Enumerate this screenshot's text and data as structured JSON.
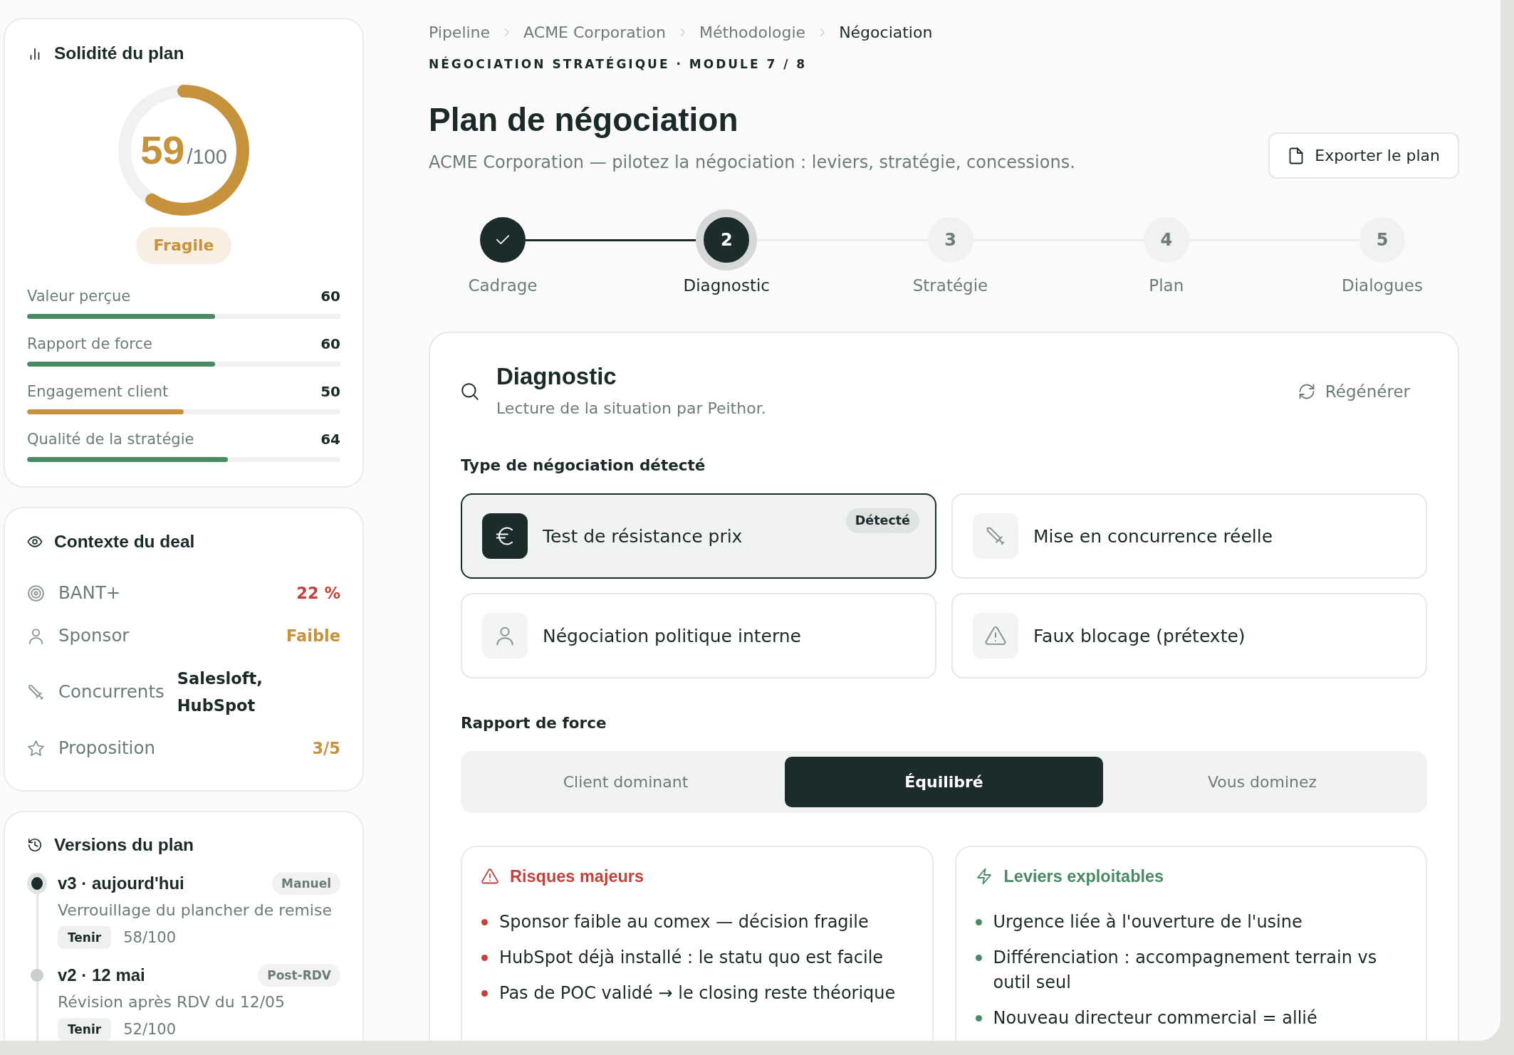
{
  "sidebar": {
    "plan_strength": {
      "title": "Solidité du plan",
      "score": "59",
      "score_max": "/100",
      "level": 0.59,
      "rating": "Fragile",
      "metrics": [
        {
          "label": "Valeur perçue",
          "value": "60",
          "level": 0.6,
          "color": "#4a8a62"
        },
        {
          "label": "Rapport de force",
          "value": "60",
          "level": 0.6,
          "color": "#4a8a62"
        },
        {
          "label": "Engagement client",
          "value": "50",
          "level": 0.5,
          "color": "#c6923c"
        },
        {
          "label": "Qualité de la stratégie",
          "value": "64",
          "level": 0.64,
          "color": "#4a8a62"
        }
      ]
    },
    "deal_context": {
      "title": "Contexte du deal",
      "rows": [
        {
          "label": "BANT+",
          "value": "22 %",
          "color": "#c0443c"
        },
        {
          "label": "Sponsor",
          "value": "Faible",
          "color": "#c6923c"
        },
        {
          "label": "Concurrents",
          "value": "Salesloft, HubSpot",
          "color": "#1b2a28"
        },
        {
          "label": "Proposition",
          "value": "3/5",
          "color": "#c6923c"
        }
      ]
    },
    "versions": {
      "title": "Versions du plan",
      "items": [
        {
          "title": "v3 · aujourd'hui",
          "badge": "Manuel",
          "description": "Verrouillage du plancher de remise",
          "tag": "Tenir",
          "score": "58/100",
          "current": true
        },
        {
          "title": "v2 · 12 mai",
          "badge": "Post-RDV",
          "description": "Révision après RDV du 12/05",
          "tag": "Tenir",
          "score": "52/100",
          "current": false
        }
      ]
    }
  },
  "breadcrumb": [
    {
      "label": "Pipeline",
      "current": false
    },
    {
      "label": "ACME Corporation",
      "current": false
    },
    {
      "label": "Méthodologie",
      "current": false
    },
    {
      "label": "Négociation",
      "current": true
    }
  ],
  "module_label": "NÉGOCIATION STRATÉGIQUE · MODULE 7 / 8",
  "title": "Plan de négociation",
  "subtitle": "ACME Corporation — pilotez la négociation : leviers, stratégie, concessions.",
  "export_button": "Exporter le plan",
  "steps": [
    {
      "label": "Cadrage",
      "completed": true,
      "selected": false
    },
    {
      "number": "2",
      "label": "Diagnostic",
      "completed": false,
      "selected": true
    },
    {
      "number": "3",
      "label": "Stratégie",
      "completed": false,
      "selected": false
    },
    {
      "number": "4",
      "label": "Plan",
      "completed": false,
      "selected": false
    },
    {
      "number": "5",
      "label": "Dialogues",
      "completed": false,
      "selected": false
    }
  ],
  "diagnostic": {
    "title": "Diagnostic",
    "subtitle": "Lecture de la situation par Peithor.",
    "regenerate_button": "Régénérer",
    "negotiation_type": {
      "heading": "Type de négociation détecté",
      "options": [
        {
          "label": "Test de résistance prix",
          "selected": true,
          "badge": "Détecté"
        },
        {
          "label": "Mise en concurrence réelle",
          "selected": false
        },
        {
          "label": "Négociation politique interne",
          "selected": false
        },
        {
          "label": "Faux blocage (prétexte)",
          "selected": false
        }
      ]
    },
    "power_balance": {
      "heading": "Rapport de force",
      "options": [
        {
          "label": "Client dominant",
          "selected": false
        },
        {
          "label": "Équilibré",
          "selected": true
        },
        {
          "label": "Vous dominez",
          "selected": false
        }
      ]
    },
    "risks": {
      "title": "Risques majeurs",
      "items": [
        "Sponsor faible au comex — décision fragile",
        "HubSpot déjà installé : le statu quo est facile",
        "Pas de POC validé → le closing reste théorique"
      ]
    },
    "levers": {
      "title": "Leviers exploitables",
      "items": [
        "Urgence liée à l'ouverture de l'usine",
        "Différenciation : accompagnement terrain vs outil seul",
        "Nouveau directeur commercial = allié"
      ]
    }
  }
}
